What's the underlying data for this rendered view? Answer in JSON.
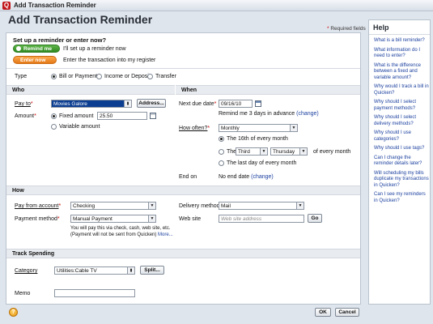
{
  "window": {
    "title": "Add Transaction Reminder"
  },
  "heading": "Add Transaction Reminder",
  "required_note": "Required fields",
  "setup": {
    "prompt": "Set up a reminder or enter now?",
    "remind_label": "Remind me",
    "remind_desc": "I'll set up a reminder now",
    "enter_label": "Enter now",
    "enter_desc": "Enter the transaction into my register"
  },
  "type": {
    "label": "Type",
    "options": [
      "Bill or Payment",
      "Income or Deposit",
      "Transfer"
    ],
    "selected": "Bill or Payment"
  },
  "who": {
    "section": "Who",
    "pay_to_label": "Pay to",
    "pay_to_value": "Movies Galore",
    "address_button": "Address...",
    "amount_label": "Amount",
    "fixed_label": "Fixed amount",
    "fixed_value": "25.50",
    "variable_label": "Variable amount"
  },
  "when": {
    "section": "When",
    "next_due_label": "Next due date",
    "next_due_value": "09/16/10",
    "remind_text": "Remind me 3 days in advance",
    "change_link": "(change)",
    "how_often_label": "How often?",
    "how_often_value": "Monthly",
    "opt1": "The 16th of every month",
    "opt2_prefix": "The",
    "opt2_ordinal": "Third",
    "opt2_day": "Thursday",
    "opt2_suffix": "of every month",
    "opt3": "The last day of every month",
    "end_on_label": "End on",
    "end_on_value": "No end date",
    "end_change_link": "(change)"
  },
  "how": {
    "section": "How",
    "pay_from_label": "Pay from account",
    "pay_from_value": "Checking",
    "payment_method_label": "Payment method",
    "payment_method_value": "Manual Payment",
    "note_line1": "You will pay this via check, cash, web site, etc.",
    "note_line2": "(Payment will not be sent from Quicken)",
    "more_link": "More...",
    "delivery_label": "Delivery method",
    "delivery_value": "Mail",
    "website_label": "Web site",
    "website_placeholder": "Web site address",
    "go_button": "Go"
  },
  "track": {
    "section": "Track Spending",
    "category_label": "Category",
    "category_value": "Utilities:Cable TV",
    "split_button": "Split...",
    "memo_label": "Memo",
    "memo_value": ""
  },
  "buttons": {
    "ok": "OK",
    "cancel": "Cancel"
  },
  "help": {
    "title": "Help",
    "items": [
      "What is a bill reminder?",
      "What information do I need to enter?",
      "What is the difference between a fixed and variable amount?",
      "Why would I track a bill in Quicken?",
      "Why should I select payment methods?",
      "Why should I select delivery methods?",
      "Why should I use categories?",
      "Why should I use tags?",
      "Can I change the reminder details later?",
      "Will scheduling my bills duplicate my transactions in Quicken?",
      "Can I see my reminders in Quicken?"
    ]
  },
  "colors": {
    "accent_green": "#2f8a22",
    "accent_orange": "#e57917",
    "link": "#1a3f9e"
  }
}
